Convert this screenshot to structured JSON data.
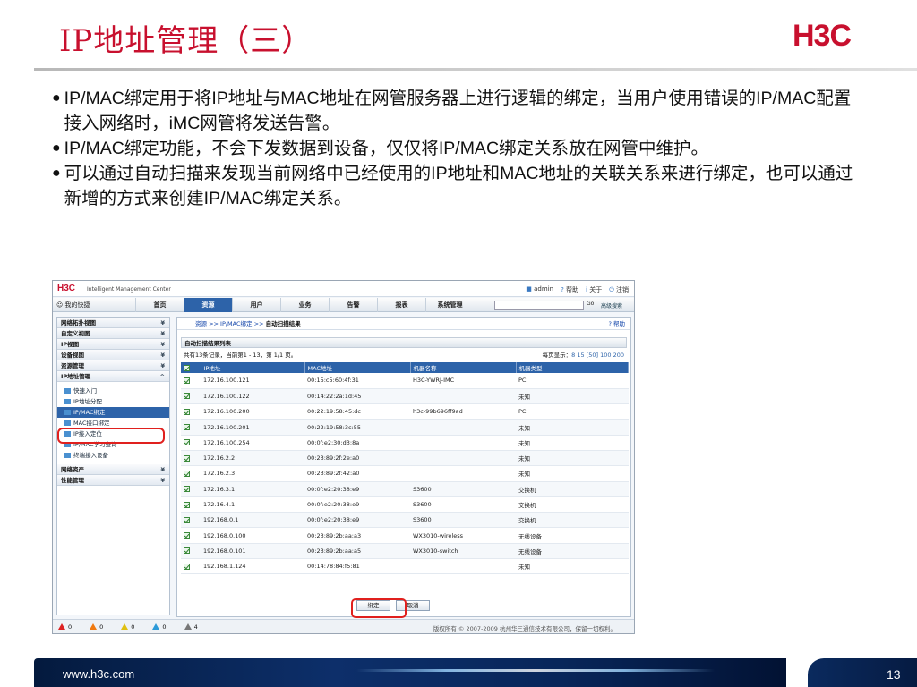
{
  "slide": {
    "title": "IP地址管理（三）",
    "bullets": [
      "IP/MAC绑定用于将IP地址与MAC地址在网管服务器上进行逻辑的绑定，当用户使用错误的IP/MAC配置接入网络时，iMC网管将发送告警。",
      "IP/MAC绑定功能，不会下发数据到设备，仅仅将IP/MAC绑定关系放在网管中维护。",
      "可以通过自动扫描来发现当前网络中已经使用的IP地址和MAC地址的关联关系来进行绑定，也可以通过新增的方式来创建IP/MAC绑定关系。"
    ],
    "bullet_symbol": "●",
    "footer_url": "www.h3c.com",
    "page_number": "13",
    "brand_color": "#c8102e"
  },
  "app": {
    "logo": "H3C",
    "product": "Intelligent Management Center",
    "user": "admin",
    "help": "帮助",
    "about": "关于",
    "logout": "注销",
    "favorites": "我的快捷",
    "tabs": [
      "首页",
      "资源",
      "用户",
      "业务",
      "告警",
      "报表",
      "系统管理"
    ],
    "active_tab": "资源",
    "search_button": "Go",
    "advanced_search": "高级搜索"
  },
  "sidebar": {
    "sections_top": [
      "网络拓扑视图",
      "自定义视图",
      "IP视图",
      "设备视图",
      "资源管理",
      "IP地址管理"
    ],
    "items": [
      "快速入门",
      "IP地址分配",
      "IP/MAC绑定",
      "MAC接口绑定",
      "IP接入定位",
      "IP/MAC学习查询",
      "终端接入设备"
    ],
    "selected_item": "IP/MAC绑定",
    "sections_bottom": [
      "网络资产",
      "性能管理"
    ]
  },
  "main": {
    "breadcrumb_root": "资源",
    "breadcrumb_mid": "IP/MAC绑定",
    "breadcrumb_current": "自动扫描结果",
    "help": "帮助",
    "panel_title": "自动扫描结果列表",
    "paging_left": "共有13条记录，当前第1 - 13，第 1/1 页。",
    "paging_right_label": "每页显示：",
    "paging_options": "8 15 [50] 100 200",
    "columns": [
      "",
      "IP地址",
      "MAC地址",
      "机器名称",
      "机器类型"
    ],
    "rows": [
      [
        "172.16.100.121",
        "00:15:c5:60:4f:31",
        "H3C-YWRJ-IMC",
        "PC"
      ],
      [
        "172.16.100.122",
        "00:14:22:2a:1d:45",
        "",
        "未知"
      ],
      [
        "172.16.100.200",
        "00:22:19:58:45:dc",
        "h3c-99b696ff9ad",
        "PC"
      ],
      [
        "172.16.100.201",
        "00:22:19:58:3c:55",
        "",
        "未知"
      ],
      [
        "172.16.100.254",
        "00:0f:e2:30:d3:8a",
        "",
        "未知"
      ],
      [
        "172.16.2.2",
        "00:23:89:2f:2e:a0",
        "",
        "未知"
      ],
      [
        "172.16.2.3",
        "00:23:89:2f:42:a0",
        "",
        "未知"
      ],
      [
        "172.16.3.1",
        "00:0f:e2:20:38:e9",
        "S3600",
        "交换机"
      ],
      [
        "172.16.4.1",
        "00:0f:e2:20:38:e9",
        "S3600",
        "交换机"
      ],
      [
        "192.168.0.1",
        "00:0f:e2:20:38:e9",
        "S3600",
        "交换机"
      ],
      [
        "192.168.0.100",
        "00:23:89:2b:aa:a3",
        "WX3010-wireless",
        "无线设备"
      ],
      [
        "192.168.0.101",
        "00:23:89:2b:aa:a5",
        "WX3010-switch",
        "无线设备"
      ],
      [
        "192.168.1.124",
        "00:14:78:84:f5:81",
        "",
        "未知"
      ]
    ],
    "bind_button": "绑定",
    "cancel_button": "取消"
  },
  "statusbar": {
    "counts": [
      "0",
      "0",
      "0",
      "0",
      "4"
    ],
    "copyright": "版权所有 © 2007-2009 杭州华三通信技术有限公司，保留一切权利。"
  }
}
